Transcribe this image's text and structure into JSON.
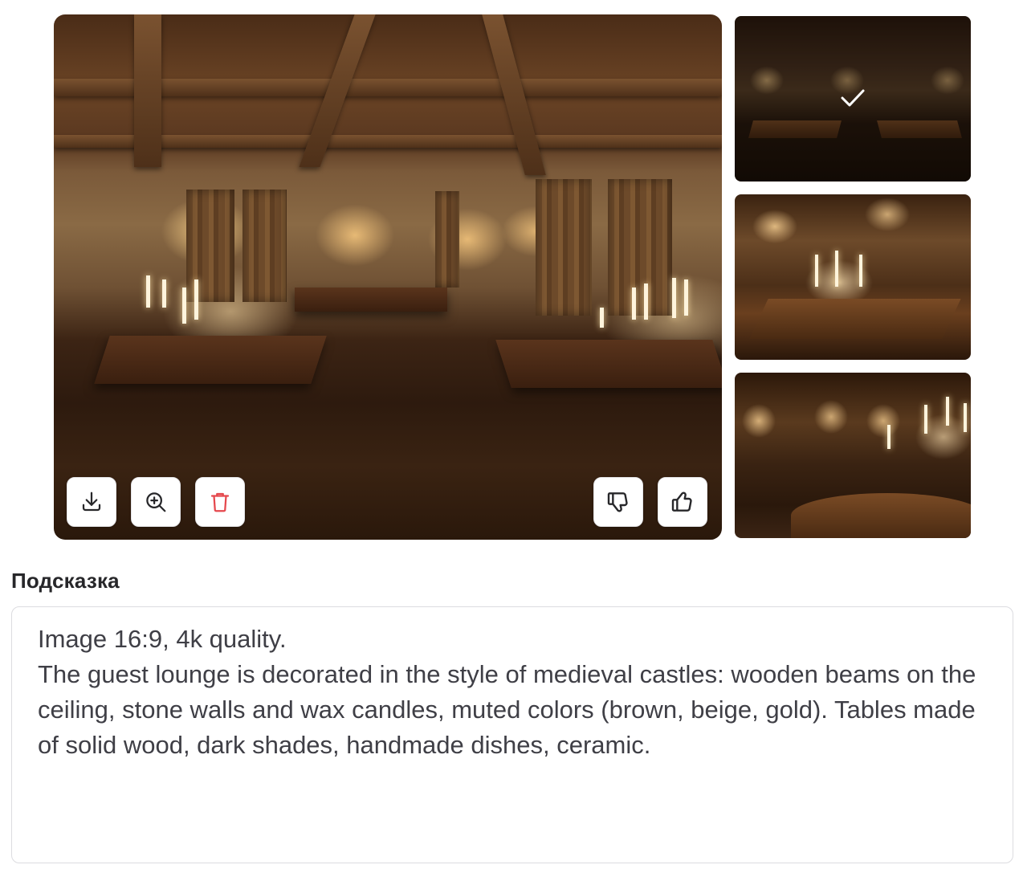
{
  "gallery": {
    "main_image": {
      "alt": "Medieval castle style guest lounge with wooden beams, stone walls and candles"
    },
    "actions": {
      "download": {
        "icon": "download-icon"
      },
      "zoom": {
        "icon": "zoom-in-icon"
      },
      "delete": {
        "icon": "trash-icon",
        "color": "#e5484d"
      },
      "dislike": {
        "icon": "thumbs-down-icon"
      },
      "like": {
        "icon": "thumbs-up-icon"
      }
    },
    "thumbnails": [
      {
        "selected": true,
        "icon": "checkmark-icon"
      },
      {
        "selected": false
      },
      {
        "selected": false
      }
    ]
  },
  "prompt": {
    "label": "Подсказка",
    "text": "Image 16:9, 4k quality.\nThe guest lounge is decorated in the style of medieval castles: wooden beams on the ceiling, stone walls and wax candles, muted colors (brown, beige, gold). Tables made of solid wood, dark shades, handmade dishes, ceramic."
  },
  "colors": {
    "text": "#3f3f46",
    "label": "#27272a",
    "border": "#dcdce0",
    "danger": "#e5484d"
  }
}
